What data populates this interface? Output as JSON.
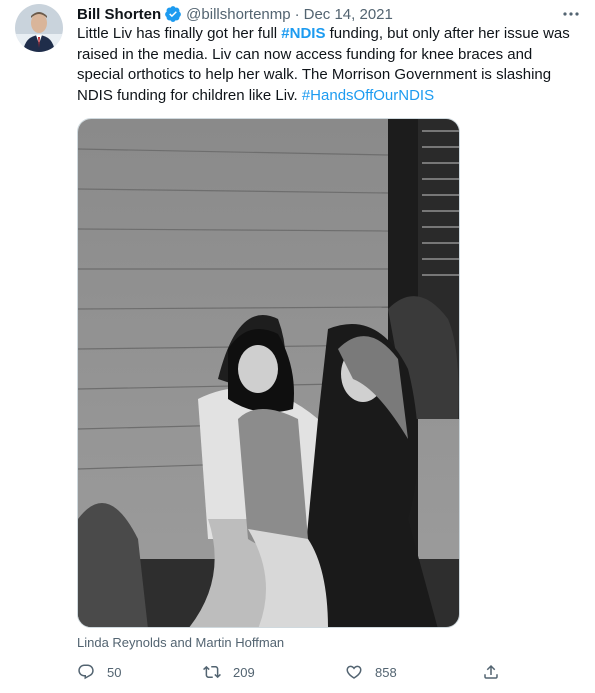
{
  "tweet": {
    "author_name": "Bill Shorten",
    "verified_icon": "verified-badge-icon",
    "handle": "@billshortenmp",
    "separator": "·",
    "date": "Dec 14, 2021",
    "more_icon": "more-options-icon",
    "text": {
      "part1": "Little Liv has finally got her full ",
      "hashtag1": "#NDIS",
      "part2": " funding, but only after her issue was raised in the media. Liv can now access funding for knee braces and special orthotics to help her walk. The Morrison Government is slashing NDIS funding for children like Liv. ",
      "hashtag2": "#HandsOffOurNDIS"
    },
    "media_caption": "Linda Reynolds and Martin Hoffman",
    "actions": {
      "replies": "50",
      "retweets": "209",
      "likes": "858"
    }
  },
  "colors": {
    "accent": "#1d9bf0",
    "text_primary": "#0f1419",
    "text_secondary": "#536471",
    "border": "#cfd9de"
  }
}
